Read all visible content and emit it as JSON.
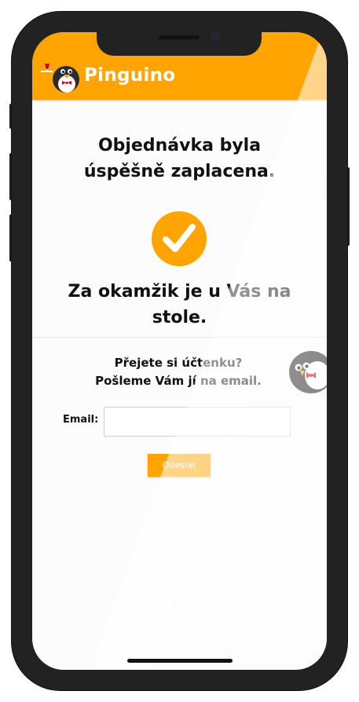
{
  "header": {
    "brand": "Pinguino",
    "background_color": "#ffa400",
    "logo_icon": "penguin-waiter-icon"
  },
  "main": {
    "title_line1": "Objednávka byla",
    "title_line2": "úspěšně zaplacena.",
    "success_icon": "checkmark-circle-icon",
    "message_line1": "Za okamžik je u Vás na",
    "message_line2": "stole."
  },
  "receipt": {
    "question": "Přejete si účtenku?",
    "offer": "Pošleme Vám jí na email.",
    "decor_icon": "penguin-peek-icon",
    "email_label": "Email:",
    "email_value": "",
    "email_placeholder": "",
    "submit_label": "Odeslat"
  },
  "colors": {
    "accent": "#ffa400",
    "phone_frame": "#222222",
    "text": "#111111"
  }
}
